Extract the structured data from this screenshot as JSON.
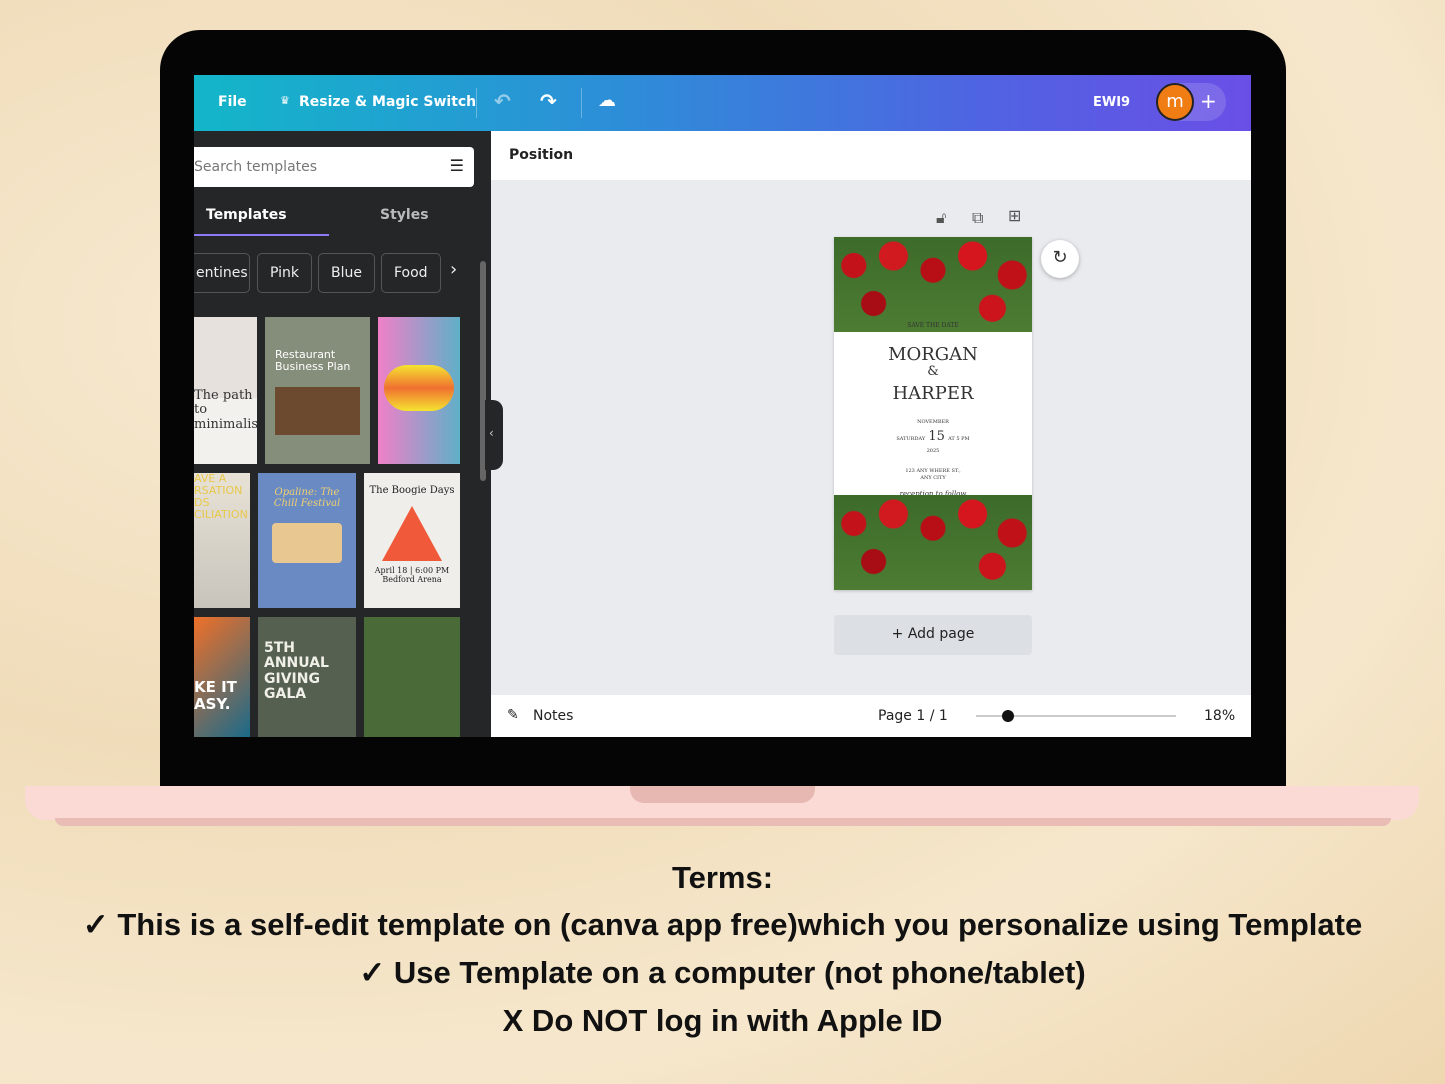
{
  "topbar": {
    "file": "File",
    "resize": "Resize & Magic Switch",
    "project": "EWI9",
    "avatar": "m",
    "plus": "+"
  },
  "panel": {
    "search_placeholder": "Search templates",
    "tabs": [
      "Templates",
      "Styles"
    ],
    "chips": [
      "entines",
      "Pink",
      "Blue",
      "Food"
    ],
    "thumbs": [
      "The path to minimalism",
      "Restaurant Business Plan",
      "",
      "AVE A RSATION DS CILIATION",
      "Opaline: The Chill Festival",
      "The Boogie Days",
      "April 18 | 6:00 PM Bedford Arena",
      "KE IT ASY.",
      "5TH ANNUAL GIVING GALA",
      ""
    ]
  },
  "canvas": {
    "position_label": "Position",
    "add_page": "+ Add page"
  },
  "invite": {
    "save": "SAVE THE DATE",
    "name1": "MORGAN",
    "amp": "&",
    "name2": "HARPER",
    "month": "NOVEMBER",
    "day": "SATURDAY",
    "date": "15",
    "time": "AT 5 PM",
    "year": "2025",
    "address1": "123 ANY WHERE ST.,",
    "address2": "ANY CITY",
    "reception": "reception to follow"
  },
  "bottombar": {
    "notes": "Notes",
    "page": "Page 1 / 1",
    "zoom": "18%",
    "zoom_value": 18
  },
  "terms": {
    "title": "Terms:",
    "line1": "✓ This is a self-edit template on (canva app free)which you personalize using Template",
    "line2": "✓ Use Template on a computer (not phone/tablet)",
    "line3": "X Do NOT log in with Apple ID"
  }
}
